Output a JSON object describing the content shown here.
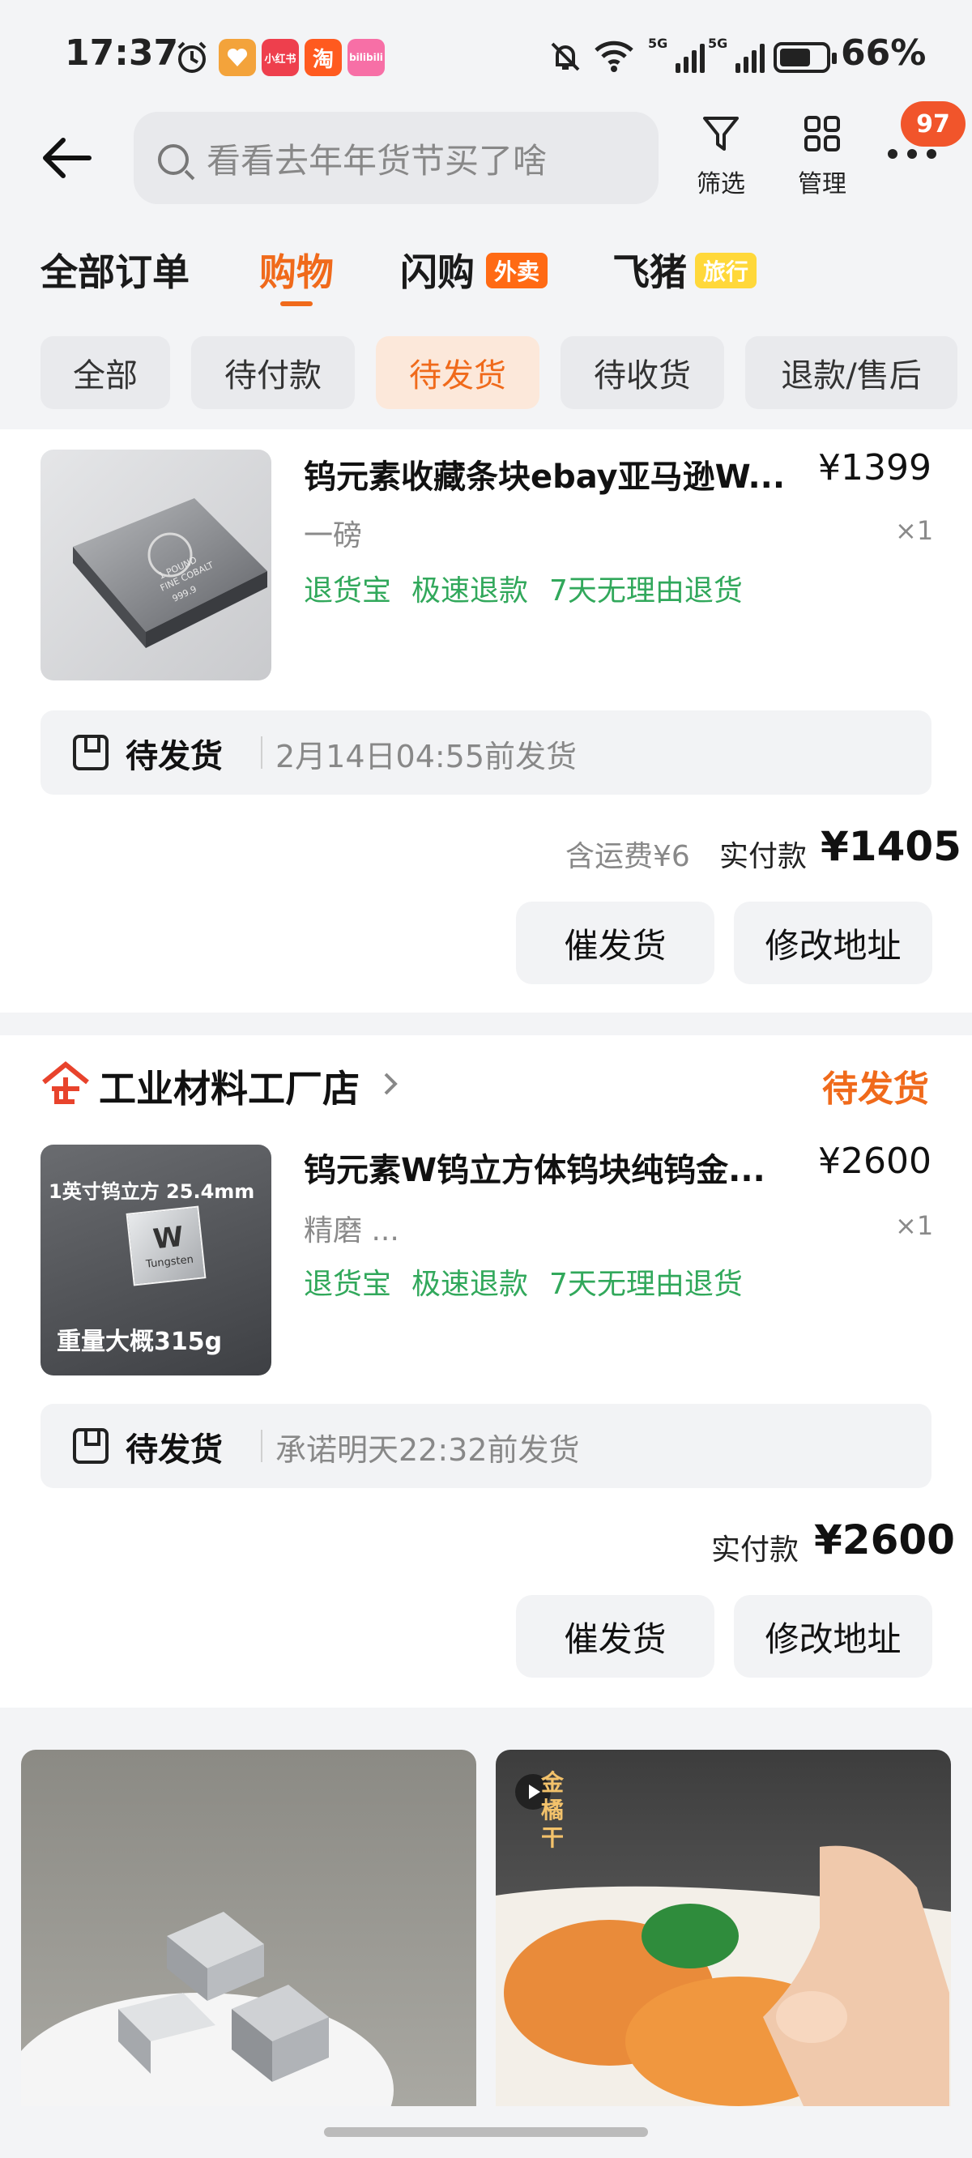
{
  "status_bar": {
    "time": "17:37",
    "battery": "66%",
    "app_icons": [
      {
        "name": "alarm-icon",
        "text": "",
        "color": "#ffffff"
      },
      {
        "name": "heart-app-icon",
        "text": "",
        "color": "#f3a33b"
      },
      {
        "name": "xiaohongshu-icon",
        "text": "小红书",
        "color": "#ee3f4d"
      },
      {
        "name": "taobao-icon",
        "text": "淘",
        "color": "#ff5a1f"
      },
      {
        "name": "bilibili-icon",
        "text": "bilibili",
        "color": "#f76fa6"
      }
    ],
    "signal_labels": [
      "5G",
      "5G"
    ]
  },
  "header": {
    "search_placeholder": "看看去年年货节买了啥",
    "filter_label": "筛选",
    "manage_label": "管理",
    "more_badge": "97"
  },
  "order_tabs": [
    {
      "label": "全部订单",
      "active": false
    },
    {
      "label": "购物",
      "active": true
    },
    {
      "label": "闪购",
      "active": false,
      "tag": "外卖",
      "tag_color": "#ff6a14"
    },
    {
      "label": "飞猪",
      "active": false,
      "tag": "旅行",
      "tag_color": "#ffd83a"
    }
  ],
  "filter_chips": [
    {
      "label": "全部",
      "active": false
    },
    {
      "label": "待付款",
      "active": false
    },
    {
      "label": "待发货",
      "active": true
    },
    {
      "label": "待收货",
      "active": false
    },
    {
      "label": "退款/售后",
      "active": false
    }
  ],
  "orders": [
    {
      "store": "",
      "status": "",
      "product_title": "钨元素收藏条块ebay亚马逊W...",
      "price": "¥1399",
      "spec": "一磅",
      "qty": "×1",
      "tags": [
        "退货宝",
        "极速退款",
        "7天无理由退货"
      ],
      "ship_status": "待发货",
      "ship_time": "2月14日04:55前发货",
      "shipping_fee": "含运费¥6",
      "paid_label": "实付款",
      "paid_amount": "¥1405",
      "btn_urge": "催发货",
      "btn_address": "修改地址",
      "image_text": "1 POUND\nFINE COBALT\n999.9"
    },
    {
      "store": "工业材料工厂店",
      "status": "待发货",
      "product_title": "钨元素W钨立方体钨块纯钨金...",
      "price": "¥2600",
      "spec": "精磨 ...",
      "qty": "×1",
      "tags": [
        "退货宝",
        "极速退款",
        "7天无理由退货"
      ],
      "ship_status": "待发货",
      "ship_time": "承诺明天22:32前发货",
      "paid_label": "实付款",
      "paid_amount": "¥2600",
      "btn_urge": "催发货",
      "btn_address": "修改地址",
      "image_caption_top": "1英寸钨立方 25.4mm",
      "image_caption_bottom": "重量大概315g",
      "cube_symbol": "W",
      "cube_name": "Tungsten"
    }
  ],
  "recommend": {
    "right_overlay": "金橘干"
  }
}
